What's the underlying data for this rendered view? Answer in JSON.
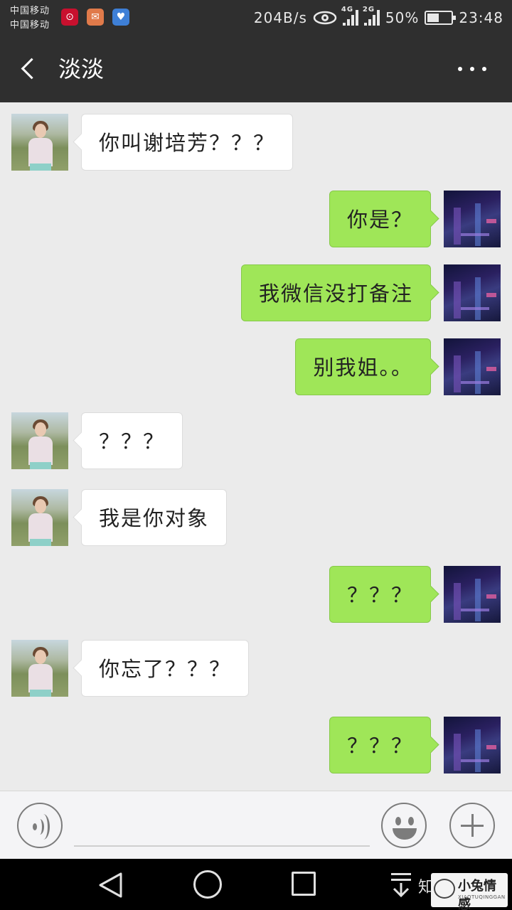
{
  "status_bar": {
    "carrier_1": "中国移动",
    "carrier_2": "中国移动",
    "speed": "204B/s",
    "net_1": "4G",
    "net_2": "2G",
    "battery": "50%",
    "time": "23:48",
    "icons": [
      "netease-music-icon",
      "mail-icon",
      "health-icon",
      "eye-icon",
      "signal-icon",
      "battery-icon"
    ]
  },
  "header": {
    "title": "淡淡"
  },
  "messages": [
    {
      "side": "left",
      "text": "你叫谢培芳？？？"
    },
    {
      "side": "right",
      "text": "你是？"
    },
    {
      "side": "right",
      "text": "我微信没打备注"
    },
    {
      "side": "right",
      "text": "别我姐。。"
    },
    {
      "side": "left",
      "text": "？？？"
    },
    {
      "side": "left",
      "text": "我是你对象"
    },
    {
      "side": "right",
      "text": "？？？"
    },
    {
      "side": "left",
      "text": "你忘了？？？"
    },
    {
      "side": "right",
      "text": "？？？"
    }
  ],
  "input_bar": {
    "value": "",
    "icons": [
      "voice-icon",
      "emoji-icon",
      "plus-icon"
    ]
  },
  "watermark": {
    "zhi": "知",
    "brand_cn": "小兔情感",
    "brand_en": "XIAOTUQINGGAN"
  },
  "colors": {
    "bar": "#2f2f2f",
    "chat_bg": "#ebebeb",
    "sent_bubble": "#9fe658",
    "received_bubble": "#ffffff"
  }
}
